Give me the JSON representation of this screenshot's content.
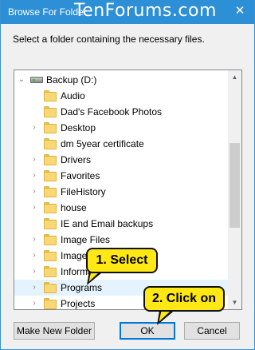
{
  "window": {
    "title": "Browse For Folder",
    "watermark": "TenForums.com",
    "close_glyph": "✕"
  },
  "instruction": "Select a folder containing the necessary files.",
  "tree": {
    "drive_label": "Backup (D:)",
    "items": [
      {
        "label": "Audio",
        "expandable": false,
        "selected": false
      },
      {
        "label": "Dad's Facebook Photos",
        "expandable": false,
        "selected": false
      },
      {
        "label": "Desktop",
        "expandable": true,
        "selected": false
      },
      {
        "label": "dm 5year certificate",
        "expandable": false,
        "selected": false
      },
      {
        "label": "Drivers",
        "expandable": true,
        "selected": false
      },
      {
        "label": "Favorites",
        "expandable": true,
        "selected": false
      },
      {
        "label": "FileHistory",
        "expandable": true,
        "selected": false
      },
      {
        "label": "house",
        "expandable": true,
        "selected": false
      },
      {
        "label": "IE and Email backups",
        "expandable": false,
        "selected": false
      },
      {
        "label": "Image Files",
        "expandable": true,
        "selected": false
      },
      {
        "label": "Image",
        "expandable": true,
        "selected": false
      },
      {
        "label": "Informat",
        "expandable": true,
        "selected": false
      },
      {
        "label": "Programs",
        "expandable": true,
        "selected": true
      },
      {
        "label": "Projects",
        "expandable": true,
        "selected": false
      }
    ]
  },
  "buttons": {
    "make_new_folder": "Make New Folder",
    "ok": "OK",
    "cancel": "Cancel"
  },
  "callouts": {
    "step1": "1. Select",
    "step2": "2. Click on"
  },
  "colors": {
    "titlebar": "#2d8fd5",
    "selection": "#e5f3ff",
    "folder": "#f8d775",
    "callout": "#ffe813",
    "default_button_border": "#0078d7"
  }
}
